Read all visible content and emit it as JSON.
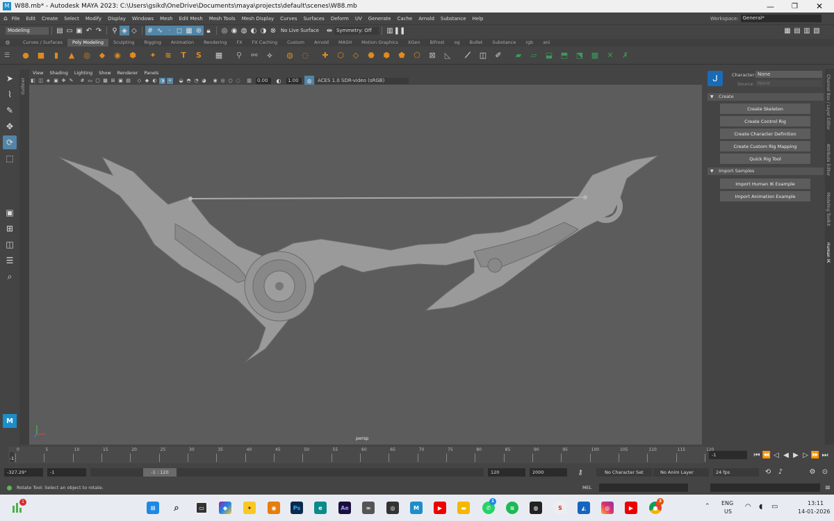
{
  "window": {
    "title": "W88.mb* - Autodesk MAYA 2023: C:\\Users\\gsikd\\OneDrive\\Documents\\maya\\projects\\default\\scenes\\W88.mb"
  },
  "menu": [
    "File",
    "Edit",
    "Create",
    "Select",
    "Modify",
    "Display",
    "Windows",
    "Mesh",
    "Edit Mesh",
    "Mesh Tools",
    "Mesh Display",
    "Curves",
    "Surfaces",
    "Deform",
    "UV",
    "Generate",
    "Cache",
    "Arnold",
    "Substance",
    "Help"
  ],
  "workspace": {
    "label": "Workspace:",
    "value": "General*"
  },
  "status": {
    "mode": "Modeling",
    "live_surface": "No Live Surface",
    "symmetry": "Symmetry: Off"
  },
  "shelf_tabs": [
    "Curves / Surfaces",
    "Poly Modeling",
    "Sculpting",
    "Rigging",
    "Animation",
    "Rendering",
    "FX",
    "FX Caching",
    "Custom",
    "Arnold",
    "MASH",
    "Motion Graphics",
    "XGen",
    "Bifrost",
    "og",
    "Bullet",
    "Substance",
    "rgb",
    "ani"
  ],
  "shelf_active": "Poly Modeling",
  "outliner_label": "Outliner",
  "viewport": {
    "menu": [
      "View",
      "Shading",
      "Lighting",
      "Show",
      "Renderer",
      "Panels"
    ],
    "field1": "0.00",
    "field2": "1.00",
    "color_space": "ACES 1.0 SDR-video (sRGB)",
    "camera": "persp"
  },
  "hik": {
    "character_label": "Character:",
    "character_value": "None",
    "source_label": "Source:",
    "source_value": "None",
    "create_label": "Create",
    "buttons": [
      "Create Skeleton",
      "Create Control Rig",
      "Create Character Definition",
      "Create Custom Rig Mapping",
      "Quick Rig Tool"
    ],
    "import_label": "Import Samples",
    "import_buttons": [
      "Import Human IK Example",
      "Import Animation Example"
    ]
  },
  "side_tabs": [
    "Channel Box / Layer Editor",
    "Attribute Editor",
    "Modeling Toolkit",
    "Human IK"
  ],
  "timeline": {
    "ticks": [
      "0",
      "5",
      "10",
      "15",
      "20",
      "25",
      "30",
      "35",
      "40",
      "45",
      "50",
      "55",
      "60",
      "65",
      "70",
      "75",
      "80",
      "85",
      "90",
      "95",
      "100",
      "105",
      "110",
      "115",
      "120"
    ],
    "current": "-1"
  },
  "range": {
    "rotate_value": "-327.29°",
    "start": "-1",
    "range_label": "-1 : 120",
    "end": "120",
    "total": "2000",
    "char_set": "No Character Set",
    "anim_layer": "No Anim Layer",
    "fps": "24 fps"
  },
  "help": {
    "mel": "MEL",
    "line": "Rotate Tool: Select an object to rotate."
  },
  "taskbar": {
    "lang1": "ENG",
    "lang2": "US",
    "time": "13:11",
    "date": "14-01-2026",
    "badge_notif": "1",
    "badge_ws": "1",
    "badge_chrome": "3"
  }
}
